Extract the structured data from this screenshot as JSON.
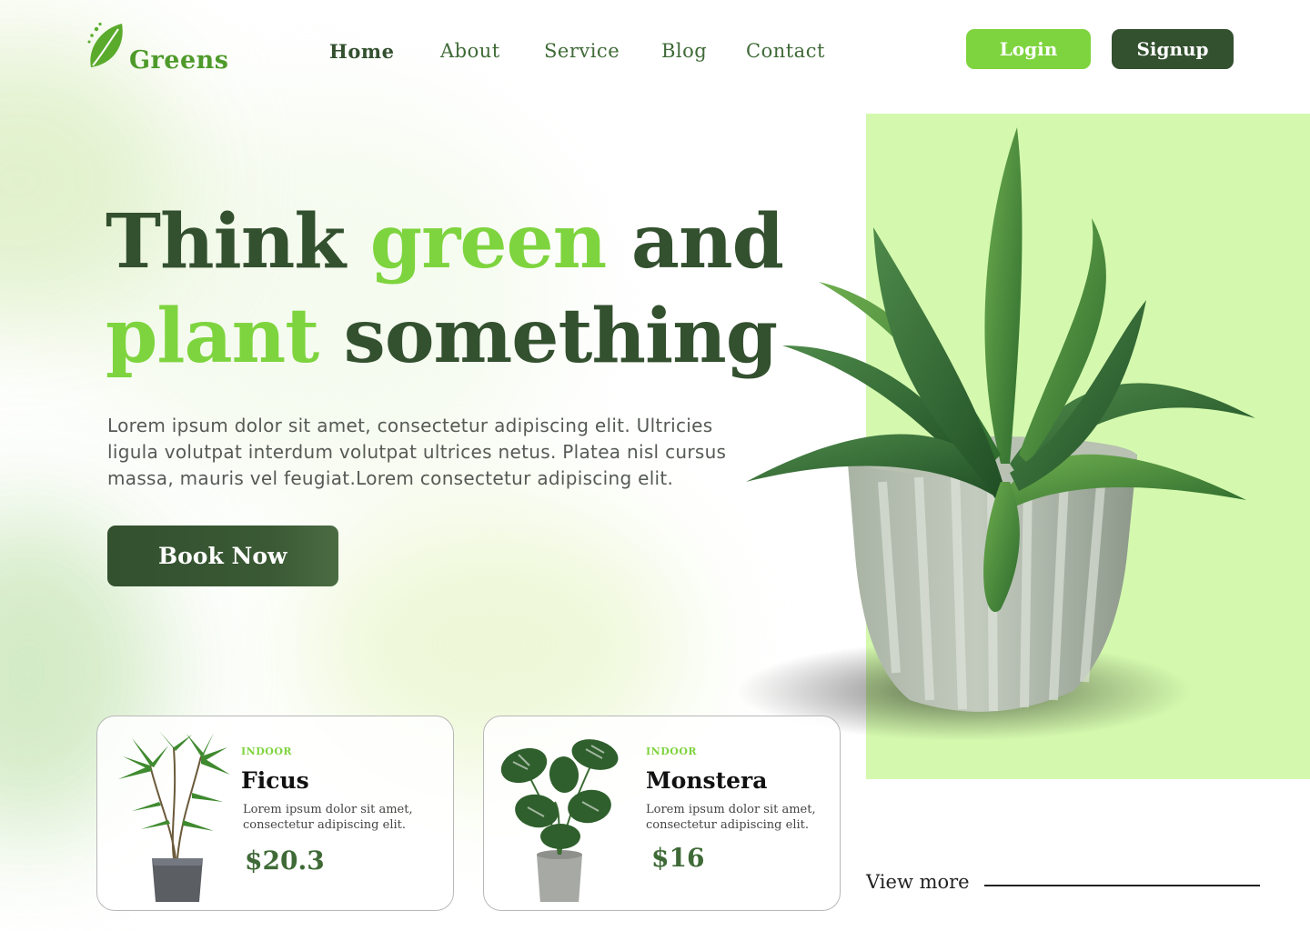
{
  "brand": {
    "name": "Greens",
    "icon": "leaf-icon"
  },
  "nav": {
    "items": [
      {
        "label": "Home",
        "active": true
      },
      {
        "label": "About",
        "active": false
      },
      {
        "label": "Service",
        "active": false
      },
      {
        "label": "Blog",
        "active": false
      },
      {
        "label": "Contact",
        "active": false
      }
    ]
  },
  "auth": {
    "login_label": "Login",
    "signup_label": "Signup"
  },
  "hero": {
    "title_part1": "Think ",
    "title_accent1": "green",
    "title_part2": " and",
    "title_accent2": "plant",
    "title_part3": " something",
    "description": "Lorem ipsum dolor sit amet, consectetur adipiscing elit. Ultricies ligula volutpat interdum volutpat ultrices netus. Platea nisl cursus massa, mauris vel feugiat.Lorem consectetur adipiscing elit.",
    "cta_label": "Book Now"
  },
  "products": [
    {
      "tag": "INDOOR",
      "name": "Ficus",
      "description": "Lorem ipsum dolor sit amet, consectetur adipiscing elit.",
      "price": "$20.3"
    },
    {
      "tag": "INDOOR",
      "name": "Monstera",
      "description": "Lorem ipsum dolor sit amet, consectetur adipiscing elit.",
      "price": "$16"
    }
  ],
  "view_more_label": "View more",
  "colors": {
    "primary_dark": "#33502f",
    "accent_green": "#7ed43e",
    "panel_green": "#d4f9ae"
  }
}
